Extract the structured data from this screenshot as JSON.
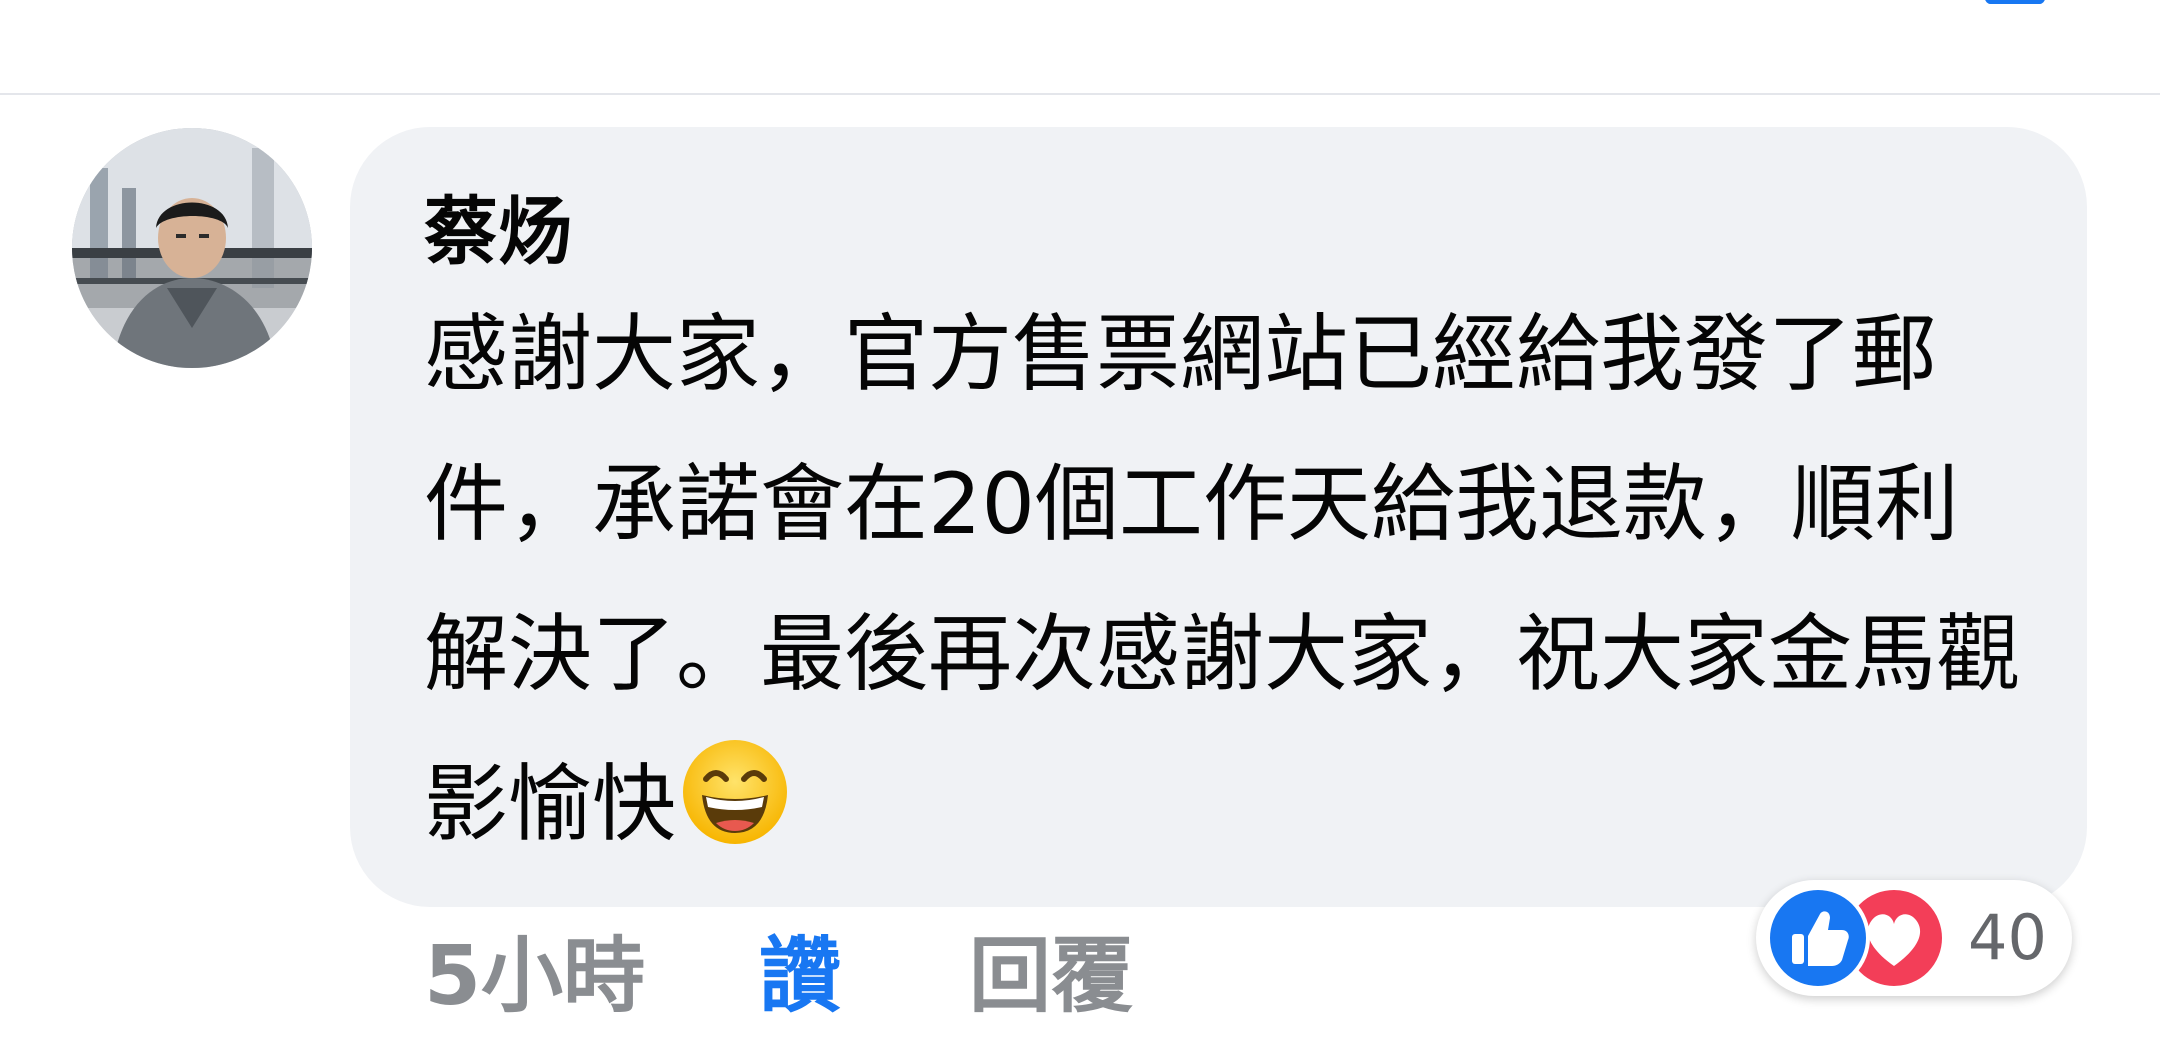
{
  "comment": {
    "author": "蔡炀",
    "text": "感謝大家，官方售票網站已經給我發了郵件，承諾會在20個工作天給我退款，順利解決了。最後再次感謝大家，祝大家金馬觀影愉快",
    "emoji": "grinning-squinting-face"
  },
  "actions": {
    "time": "5小時",
    "like_label": "讚",
    "reply_label": "回覆"
  },
  "reactions": {
    "types": [
      "like",
      "love"
    ],
    "count": "40"
  },
  "colors": {
    "accent": "#1877f2",
    "bubble": "#f0f2f5",
    "love": "#f33e58",
    "muted_text": "#8a8d91"
  }
}
